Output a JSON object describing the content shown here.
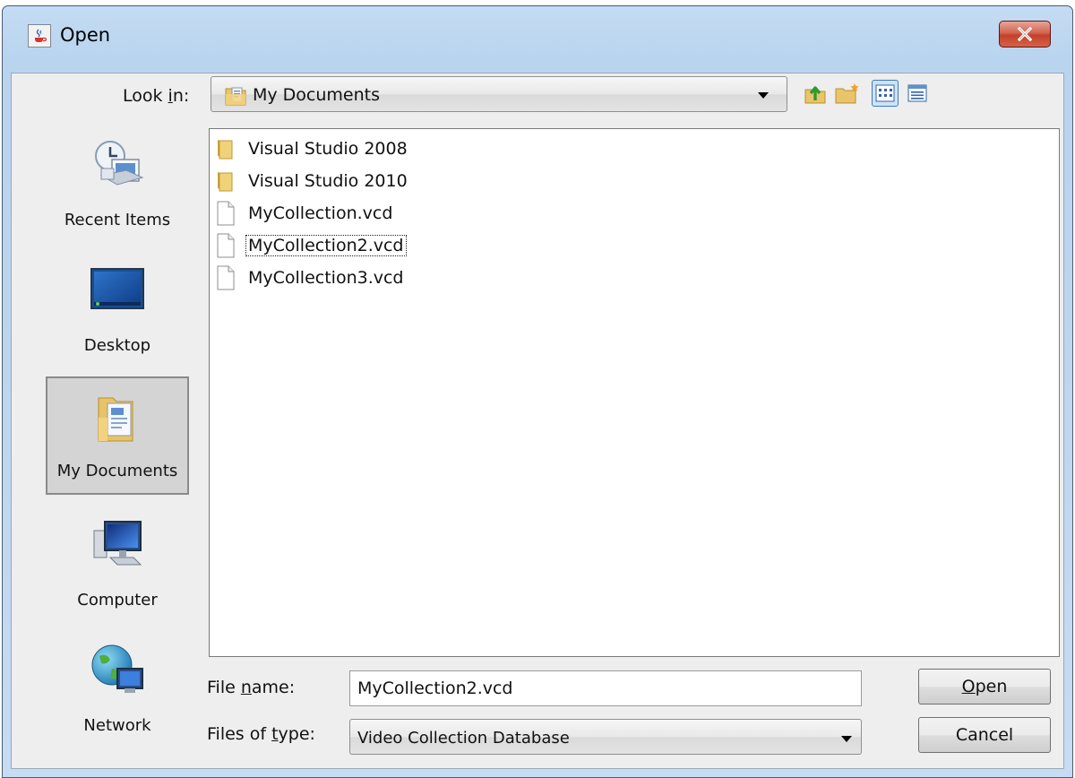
{
  "window": {
    "title": "Open",
    "icons": {
      "app": "java-cup-icon",
      "close": "close-icon"
    }
  },
  "look_in": {
    "label_pre": "Look ",
    "label_mnemonic": "i",
    "label_post": "n:",
    "value": "My Documents",
    "icon": "documents-folder-icon"
  },
  "toolbar": {
    "up": "up-one-level-icon",
    "new_folder": "new-folder-icon",
    "list": "list-view-icon",
    "details": "details-view-icon"
  },
  "places": [
    {
      "label": "Recent Items",
      "icon": "recent-items-icon",
      "selected": false
    },
    {
      "label": "Desktop",
      "icon": "desktop-icon",
      "selected": false
    },
    {
      "label": "My Documents",
      "icon": "my-documents-icon",
      "selected": true
    },
    {
      "label": "Computer",
      "icon": "computer-icon",
      "selected": false
    },
    {
      "label": "Network",
      "icon": "network-icon",
      "selected": false
    }
  ],
  "files": [
    {
      "name": "Visual Studio 2008",
      "kind": "folder"
    },
    {
      "name": "Visual Studio 2010",
      "kind": "folder"
    },
    {
      "name": "MyCollection.vcd",
      "kind": "file"
    },
    {
      "name": "MyCollection2.vcd",
      "kind": "file",
      "focused": true
    },
    {
      "name": "MyCollection3.vcd",
      "kind": "file"
    }
  ],
  "file_name": {
    "label_pre": "File ",
    "label_mnemonic": "n",
    "label_post": "ame:",
    "value": "MyCollection2.vcd"
  },
  "file_type": {
    "label_pre": "Files of ",
    "label_mnemonic": "t",
    "label_post": "ype:",
    "value": "Video Collection Database"
  },
  "buttons": {
    "open_mnemonic": "O",
    "open_rest": "pen",
    "cancel": "Cancel"
  }
}
